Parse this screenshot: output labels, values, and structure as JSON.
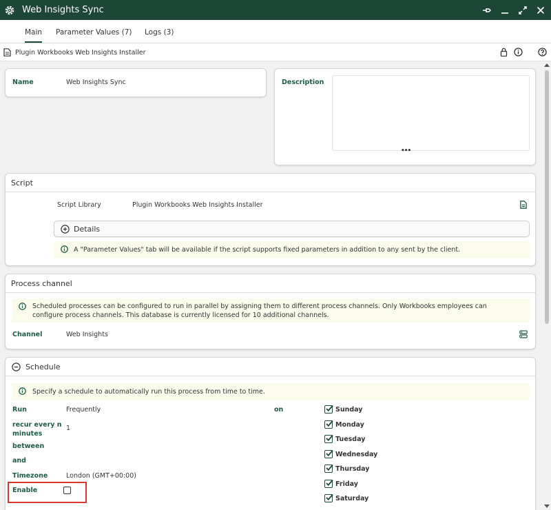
{
  "window": {
    "title": "Web Insights Sync",
    "app_icon": "gear-icon",
    "controls": [
      "pin-icon",
      "minimize-icon",
      "maximize-icon",
      "close-icon"
    ]
  },
  "tabs": [
    {
      "label": "Main",
      "active": true
    },
    {
      "label": "Parameter Values (7)",
      "active": false
    },
    {
      "label": "Logs (3)",
      "active": false
    }
  ],
  "breadcrumb": {
    "text": "Plugin Workbooks Web Insights Installer",
    "icons": [
      "lock-icon",
      "info-icon",
      "help-icon"
    ]
  },
  "name_card": {
    "label": "Name",
    "value": "Web Insights Sync"
  },
  "description_card": {
    "label": "Description",
    "value": "",
    "more": "•••"
  },
  "script": {
    "header": "Script",
    "library_label": "Script Library",
    "library_value": "Plugin Workbooks Web Insights Installer",
    "details_label": "Details",
    "info": "A \"Parameter Values\" tab will be available if the script supports fixed parameters in addition to any sent by the client."
  },
  "process_channel": {
    "header": "Process channel",
    "info_line1": "Scheduled processes can be configured to run in parallel by assigning them to different process channels. Only Workbooks employees can",
    "info_line2": "configure process channels. This database is currently licensed for 10 additional channels.",
    "channel_label": "Channel",
    "channel_value": "Web Insights"
  },
  "schedule": {
    "header": "Schedule",
    "info": "Specify a schedule to automatically run this process from time to time.",
    "run_label": "Run",
    "run_value": "Frequently",
    "recur_label_1": "recur every n",
    "recur_label_2": "minutes",
    "recur_value": "1",
    "between_label": "between",
    "and_label": "and",
    "timezone_label": "Timezone",
    "timezone_value": "London (GMT+00:00)",
    "enable_label": "Enable",
    "enable_checked": false,
    "on_label": "on",
    "days": [
      {
        "label": "Sunday",
        "checked": true
      },
      {
        "label": "Monday",
        "checked": true
      },
      {
        "label": "Tuesday",
        "checked": true
      },
      {
        "label": "Wednesday",
        "checked": true
      },
      {
        "label": "Thursday",
        "checked": true
      },
      {
        "label": "Friday",
        "checked": true
      },
      {
        "label": "Saturday",
        "checked": true
      }
    ]
  },
  "colors": {
    "titlebar": "#1e4636",
    "label": "#1e5c46",
    "info_bg": "#fbfbec",
    "highlight": "#d9392b"
  }
}
